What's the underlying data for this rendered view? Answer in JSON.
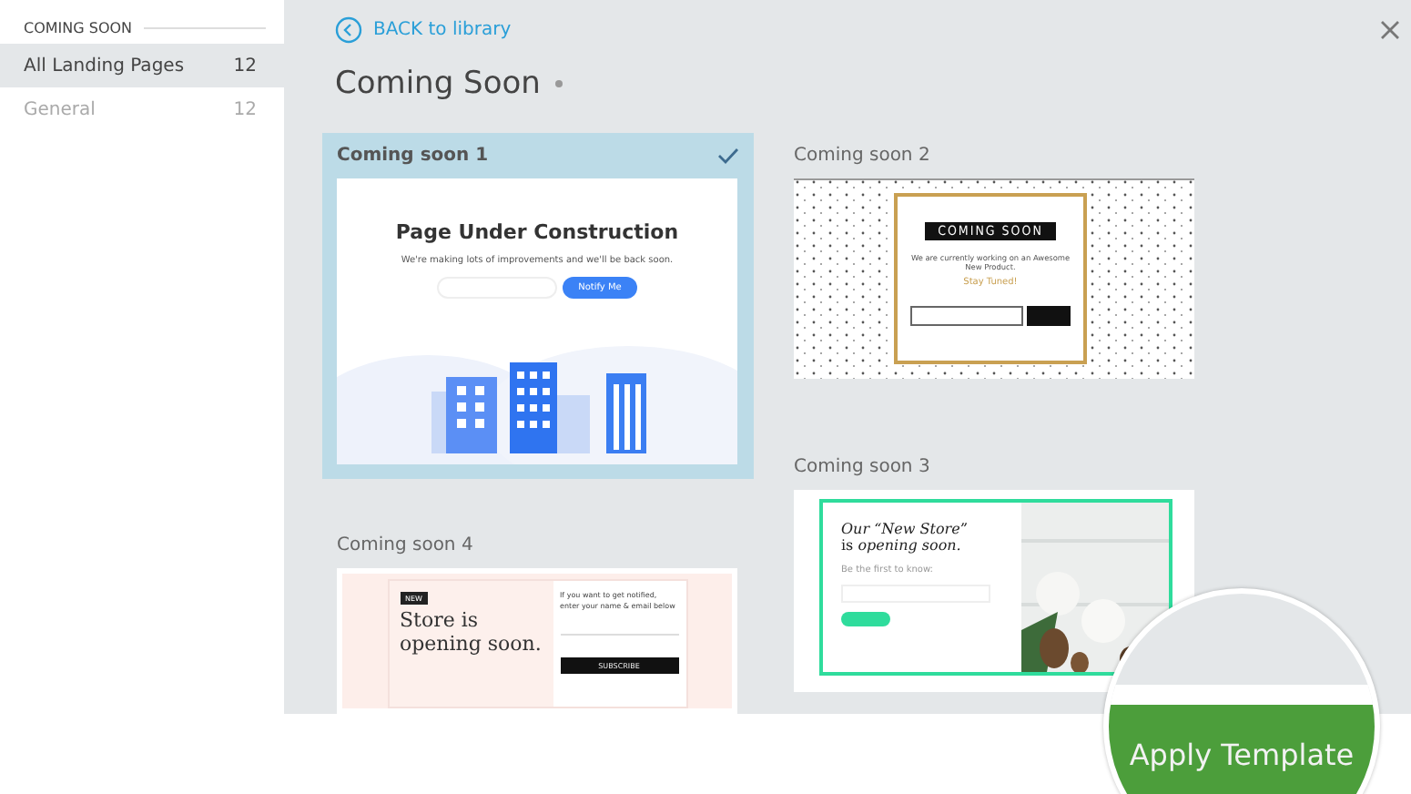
{
  "sidebar": {
    "heading": "COMING SOON",
    "items": [
      {
        "label": "All Landing Pages",
        "count": "12",
        "selected": true
      },
      {
        "label": "General",
        "count": "12",
        "selected": false
      }
    ]
  },
  "header": {
    "back_link": "BACK to library",
    "title": "Coming Soon"
  },
  "templates": [
    {
      "name": "Coming soon 1",
      "selected": true,
      "kind": "construction",
      "headline": "Page Under Construction",
      "text": "We're making lots of improvements and we'll be back soon.",
      "button": "Notify Me"
    },
    {
      "name": "Coming soon 2",
      "selected": false,
      "kind": "banner",
      "headline": "COMING SOON",
      "text": "We are currently working on an Awesome New Product.",
      "accent": "Stay Tuned!"
    },
    {
      "name": "Coming soon 3",
      "selected": false,
      "kind": "store",
      "headline": "*Our “New Store”*",
      "subhead": "is *opening soon.*",
      "text": "Be the first to know:"
    },
    {
      "name": "Coming soon 4",
      "selected": false,
      "kind": "notice",
      "badge": "NEW",
      "headline": "Store is opening soon.",
      "text": "If you want to get notified, enter your name & email below",
      "button": "SUBSCRIBE"
    }
  ],
  "apply_button": "Apply Template"
}
